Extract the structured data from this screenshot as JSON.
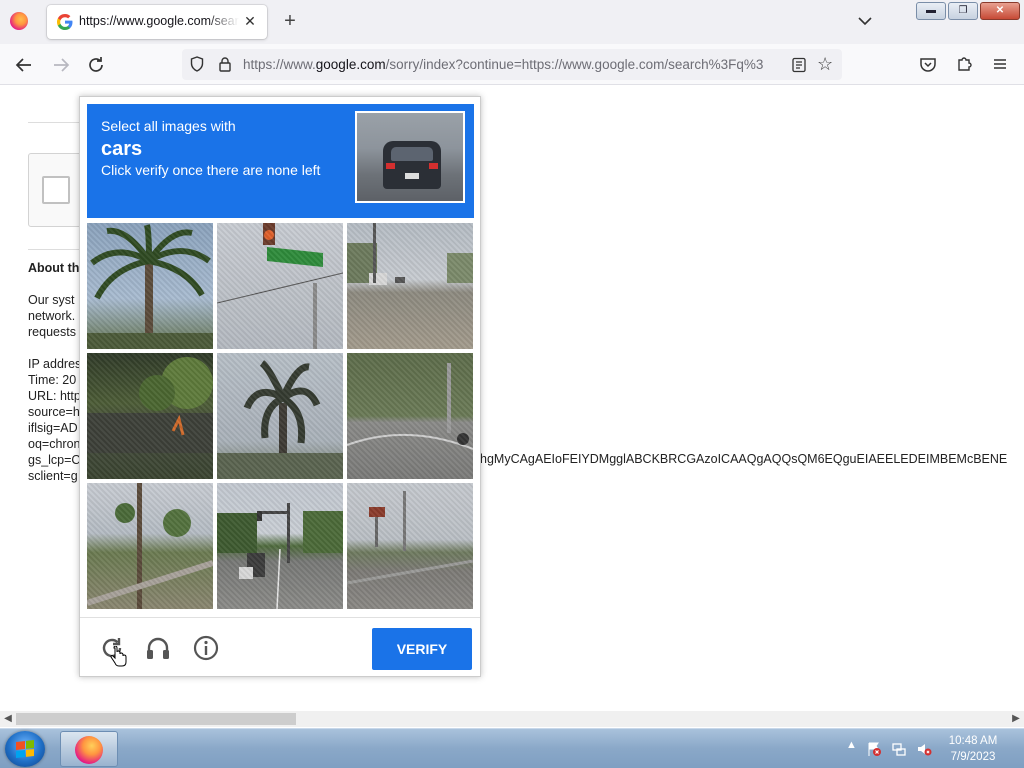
{
  "browser": {
    "tab_title": "https://www.google.com/search?q",
    "close_tab": "✕",
    "new_tab": "+",
    "url_host_prefix": "https://www.",
    "url_host": "google.com",
    "url_path": "/sorry/index?continue=https://www.google.com/search%3Fq%3",
    "star": "☆"
  },
  "window": {
    "minimize": "▬",
    "maximize": "❐",
    "close": "✕"
  },
  "page": {
    "about_heading": "About th",
    "para_lines": [
      "Our syst",
      "network.",
      "requests"
    ],
    "info_lines": [
      "IP addres",
      "Time: 20",
      "URL: http",
      "source=h",
      "iflsig=AD",
      "oq=chron",
      "gs_lcp=C",
      "sclient=g"
    ],
    "gs_lcp_tail": "hgMyCAgAEIoFEIYDMgglABCKBRCGAzoICAAQgAQQsQM6EQguEIAEELEDEIMBEMcBENE"
  },
  "captcha": {
    "instruction": "Select all images with",
    "keyword": "cars",
    "sub_instruction": "Click verify once there are none left",
    "verify_label": "VERIFY",
    "tiles": [
      "palm-tree",
      "street-sign",
      "road-with-cars",
      "bushes-wall",
      "palm-tree-2",
      "road-corner",
      "trees-sidewalk",
      "road-traffic-light",
      "road-billboard"
    ]
  },
  "taskbar": {
    "time": "10:48 AM",
    "date": "7/9/2023",
    "tray_arrow": "▲"
  },
  "scrollbar": {
    "left_arrow": "◀",
    "right_arrow": "▶"
  }
}
